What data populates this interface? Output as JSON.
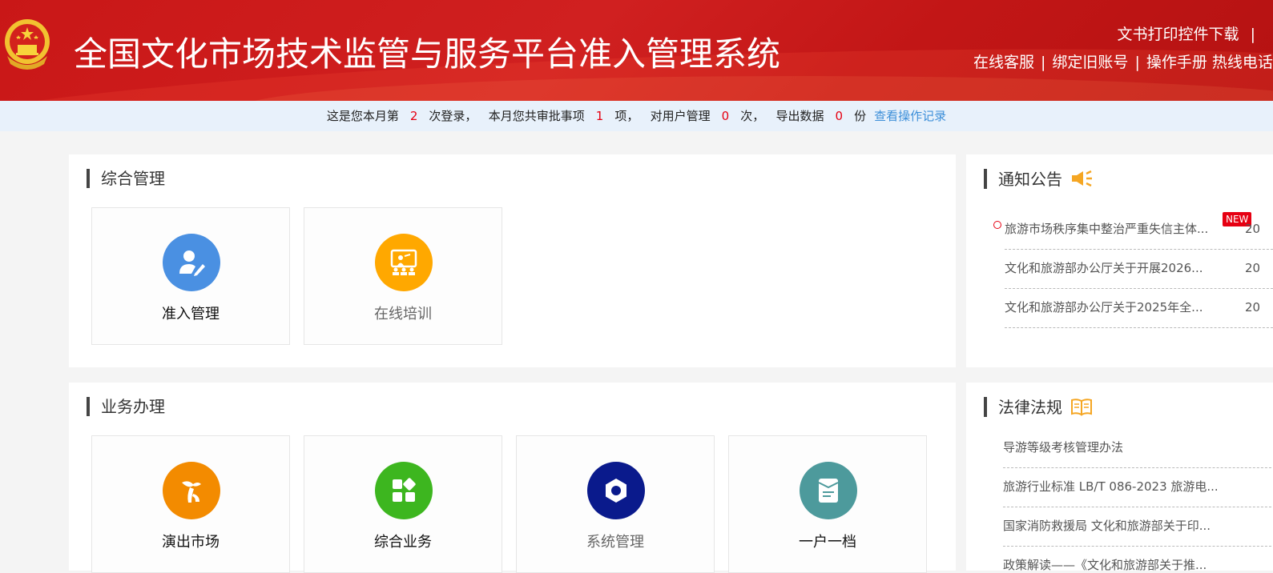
{
  "header": {
    "title": "全国文化市场技术监管与服务平台准入管理系统",
    "links_row1": [
      "文书打印控件下载",
      "|"
    ],
    "links_row2": [
      "在线客服",
      "绑定旧账号",
      "操作手册",
      "热线电话"
    ]
  },
  "stats": {
    "p1": "这是您本月第",
    "login_count": "2",
    "p2": "次登录，",
    "p3": "本月您共审批事项",
    "approve_count": "1",
    "p4": "项，",
    "p5": "对用户管理",
    "user_count": "0",
    "p6": "次，",
    "p7": "导出数据",
    "export_count": "0",
    "p8": "份",
    "link": "查看操作记录"
  },
  "general": {
    "title": "综合管理",
    "tiles": [
      {
        "label": "准入管理",
        "icon": "user-edit-icon",
        "color": "#4a90e2"
      },
      {
        "label": "在线培训",
        "icon": "training-board-icon",
        "color": "#ffa800"
      }
    ]
  },
  "business": {
    "title": "业务办理",
    "tiles": [
      {
        "label": "演出市场",
        "icon": "performance-icon",
        "color": "#f38b00"
      },
      {
        "label": "综合业务",
        "icon": "grid-apps-icon",
        "color": "#3db61f"
      },
      {
        "label": "系统管理",
        "icon": "gear-icon",
        "color": "#0a1a8c"
      },
      {
        "label": "一户一档",
        "icon": "document-file-icon",
        "color": "#4d9a9c"
      }
    ]
  },
  "notice": {
    "title": "通知公告",
    "items": [
      {
        "text": "旅游市场秩序集中整治严重失信主体...",
        "date": "20",
        "badge": "NEW"
      },
      {
        "text": "文化和旅游部办公厅关于开展2026...",
        "date": "20"
      },
      {
        "text": "文化和旅游部办公厅关于2025年全...",
        "date": "20"
      }
    ]
  },
  "law": {
    "title": "法律法规",
    "items": [
      {
        "text": "导游等级考核管理办法"
      },
      {
        "text": "旅游行业标准 LB/T 086-2023 旅游电..."
      },
      {
        "text": "国家消防救援局 文化和旅游部关于印..."
      },
      {
        "text": "政策解读——《文化和旅游部关于推..."
      }
    ]
  }
}
